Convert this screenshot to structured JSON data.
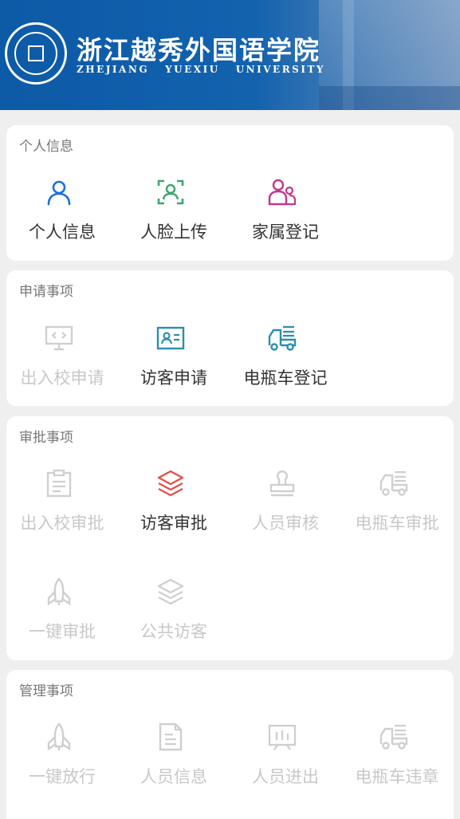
{
  "header": {
    "school_name_cn": "浙江越秀外国语学院",
    "school_name_en": "ZHEJIANG   YUEXIU   UNIVERSITY",
    "banner_color": "#0d5aa7"
  },
  "sections": {
    "personal": {
      "title": "个人信息",
      "items": [
        {
          "label": "个人信息",
          "icon": "user-icon",
          "color": "#1e6fe0",
          "enabled": true
        },
        {
          "label": "人脸上传",
          "icon": "face-scan-icon",
          "color": "#3aa76d",
          "enabled": true
        },
        {
          "label": "家属登记",
          "icon": "family-icon",
          "color": "#c23a8a",
          "enabled": true
        }
      ]
    },
    "apply": {
      "title": "申请事项",
      "items": [
        {
          "label": "出入校申请",
          "icon": "monitor-code-icon",
          "color": "#cfcfcf",
          "enabled": false
        },
        {
          "label": "访客申请",
          "icon": "id-card-icon",
          "color": "#2a8fb0",
          "enabled": true
        },
        {
          "label": "电瓶车登记",
          "icon": "truck-icon",
          "color": "#2a8fb0",
          "enabled": true
        }
      ]
    },
    "approve": {
      "title": "审批事项",
      "items": [
        {
          "label": "出入校审批",
          "icon": "clipboard-icon",
          "color": "#cfcfcf",
          "enabled": false
        },
        {
          "label": "访客审批",
          "icon": "layers-icon",
          "color": "#e0524a",
          "enabled": true
        },
        {
          "label": "人员审核",
          "icon": "stamp-icon",
          "color": "#cfcfcf",
          "enabled": false
        },
        {
          "label": "电瓶车审批",
          "icon": "truck-icon",
          "color": "#cfcfcf",
          "enabled": false
        },
        {
          "label": "一键审批",
          "icon": "rocket-icon",
          "color": "#cfcfcf",
          "enabled": false
        },
        {
          "label": "公共访客",
          "icon": "layers-icon",
          "color": "#cfcfcf",
          "enabled": false
        }
      ]
    },
    "manage": {
      "title": "管理事项",
      "items": [
        {
          "label": "一键放行",
          "icon": "rocket-icon",
          "color": "#cfcfcf",
          "enabled": false
        },
        {
          "label": "人员信息",
          "icon": "document-icon",
          "color": "#cfcfcf",
          "enabled": false
        },
        {
          "label": "人员进出",
          "icon": "chart-board-icon",
          "color": "#cfcfcf",
          "enabled": false
        },
        {
          "label": "电瓶车违章",
          "icon": "truck-icon",
          "color": "#cfcfcf",
          "enabled": false
        }
      ]
    }
  }
}
